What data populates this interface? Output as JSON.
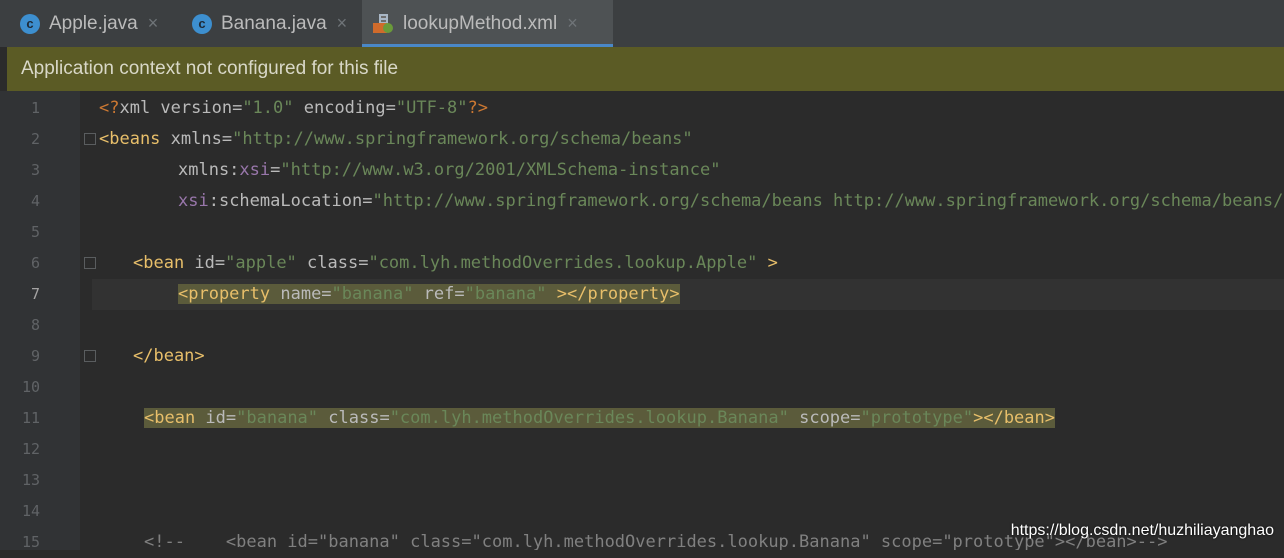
{
  "tabs": [
    {
      "label": "Apple.java",
      "icon": "class-c-icon",
      "active": false
    },
    {
      "label": "Banana.java",
      "icon": "class-c-icon",
      "active": false
    },
    {
      "label": "lookupMethod.xml",
      "icon": "xml-spring-file-icon",
      "active": true
    }
  ],
  "icon_letter": "c",
  "close_glyph": "×",
  "banner": "Application context not configured for this file",
  "line_numbers": [
    "1",
    "2",
    "3",
    "4",
    "5",
    "6",
    "7",
    "8",
    "9",
    "10",
    "11",
    "12",
    "13",
    "14",
    "15"
  ],
  "current_line": "7",
  "code": {
    "l1": {
      "p1": "<?",
      "p2": "xml version=",
      "p3": "\"1.0\"",
      "p4": " encoding=",
      "p5": "\"UTF-8\"",
      "p6": "?>"
    },
    "l2": {
      "p1": "<beans ",
      "p2": "xmlns=",
      "p3": "\"http://www.springframework.org/schema/beans\""
    },
    "l3": {
      "p1": "xmlns:",
      "p2": "xsi",
      "p3": "=",
      "p4": "\"http://www.w3.org/2001/XMLSchema-instance\""
    },
    "l4": {
      "p1": "xsi",
      "p2": ":schemaLocation=",
      "p3": "\"http://www.springframework.org/schema/beans http://www.springframework.org/schema/beans/spring-beans.xsd\""
    },
    "l6": {
      "p1": "<bean ",
      "p2": "id=",
      "p3": "\"apple\"",
      "p4": " class=",
      "p5": "\"com.lyh.methodOverrides.lookup.Apple\"",
      "p6": " >"
    },
    "l7": {
      "p1": "<property ",
      "p2": "name=",
      "p3": "\"banana\"",
      "p4": " ref=",
      "p5": "\"banana\"",
      "p6": " ></property>"
    },
    "l9": {
      "p1": "</bean>"
    },
    "l11": {
      "p1": "<bean ",
      "p2": "id=",
      "p3": "\"banana\"",
      "p4": " class=",
      "p5": "\"com.lyh.methodOverrides.lookup.Banana\"",
      "p6": " scope=",
      "p7": "\"prototype\"",
      "p8": "></bean>"
    },
    "l15": {
      "p1": "<!--    <bean id=\"banana\" class=\"com.lyh.methodOverrides.lookup.Banana\" scope=\"prototype\"></bean>-->"
    }
  },
  "watermark": "https://blog.csdn.net/huzhiliayanghao",
  "colors": {
    "tag": "#e8bf6a",
    "attr": "#bababa",
    "value": "#6a8759",
    "namespace": "#9876aa",
    "banner_bg": "#5b5b25",
    "accent": "#4a88c7"
  }
}
